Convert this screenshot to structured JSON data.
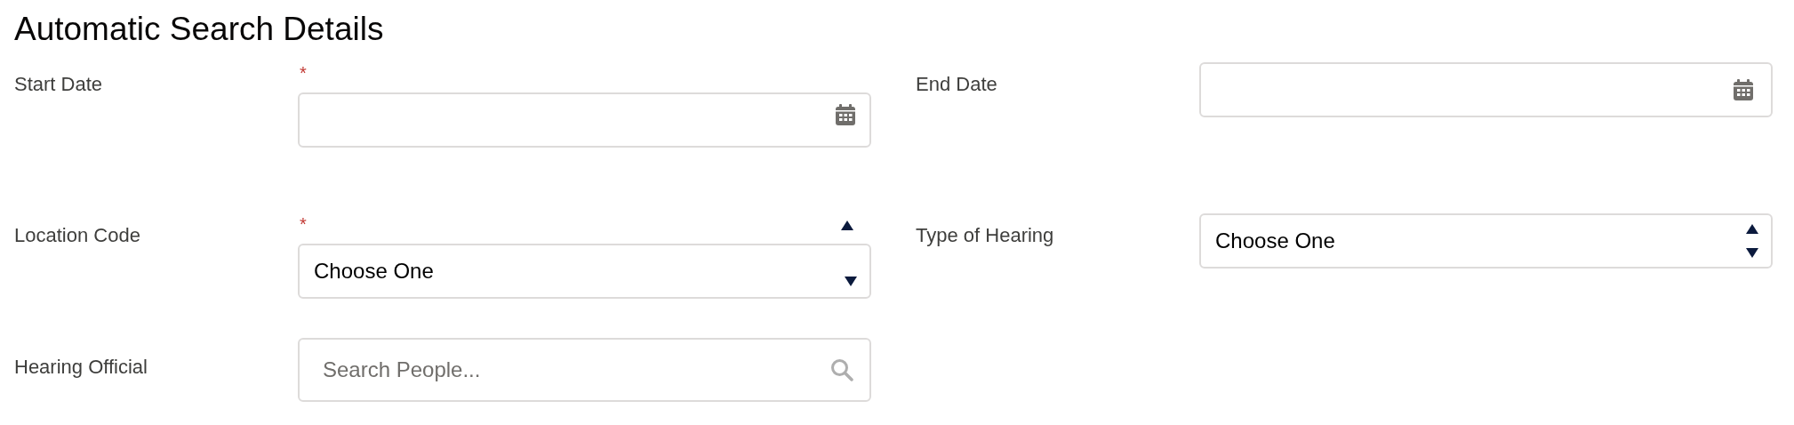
{
  "title": "Automatic Search Details",
  "rows": [
    {
      "fields": [
        {
          "label": "Start Date",
          "kind": "date",
          "required_mark": "*"
        },
        {
          "label": "End Date",
          "kind": "date"
        }
      ]
    },
    {
      "fields": [
        {
          "label": "Location Code",
          "kind": "select",
          "required_mark": "*",
          "value": "Choose One"
        },
        {
          "label": "Type of Hearing",
          "kind": "select",
          "value": "Choose One"
        }
      ]
    },
    {
      "fields": [
        {
          "label": "Hearing Official",
          "kind": "lookup",
          "placeholder": "Search People..."
        }
      ]
    }
  ]
}
